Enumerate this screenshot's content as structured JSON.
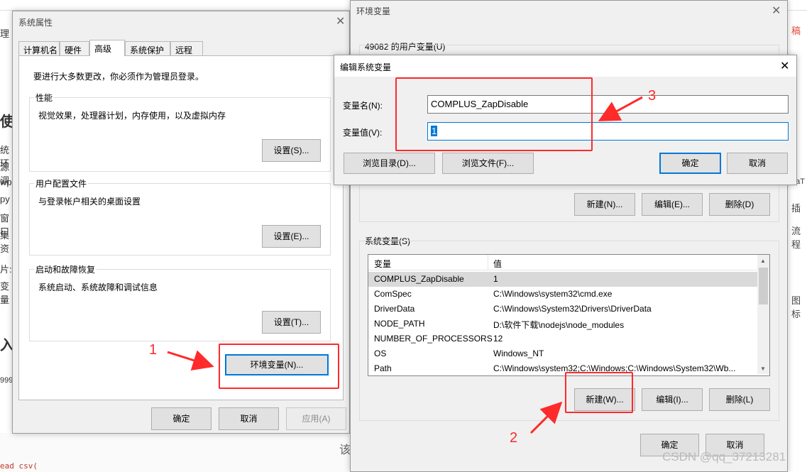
{
  "background": {
    "left_fragments": [
      "理",
      "使",
      "统环",
      "源调",
      "wp",
      "py",
      "窗口",
      "集资",
      "片:",
      "变量",
      "入",
      "999"
    ],
    "right_fragments": [
      "稿",
      "LaT",
      "插",
      "流程",
      "图标"
    ],
    "bottom_code": "ead csv(",
    "bottom_text": "该"
  },
  "system_properties": {
    "title": "系统属性",
    "tabs": [
      "计算机名",
      "硬件",
      "高级",
      "系统保护",
      "远程"
    ],
    "active_tab": "高级",
    "admin_note": "要进行大多数更改，你必须作为管理员登录。",
    "groups": [
      {
        "title": "性能",
        "desc": "视觉效果，处理器计划，内存使用，以及虚拟内存",
        "button": "设置(S)..."
      },
      {
        "title": "用户配置文件",
        "desc": "与登录帐户相关的桌面设置",
        "button": "设置(E)..."
      },
      {
        "title": "启动和故障恢复",
        "desc": "系统启动、系统故障和调试信息",
        "button": "设置(T)..."
      }
    ],
    "env_button": "环境变量(N)...",
    "ok": "确定",
    "cancel": "取消",
    "apply": "应用(A)"
  },
  "env_vars": {
    "title": "环境变量",
    "user_section": "49082 的用户变量(U)",
    "user_buttons": {
      "new": "新建(N)...",
      "edit": "编辑(E)...",
      "delete": "删除(D)"
    },
    "system_section": "系统变量(S)",
    "columns": [
      "变量",
      "值"
    ],
    "rows": [
      [
        "COMPLUS_ZapDisable",
        "1"
      ],
      [
        "ComSpec",
        "C:\\Windows\\system32\\cmd.exe"
      ],
      [
        "DriverData",
        "C:\\Windows\\System32\\Drivers\\DriverData"
      ],
      [
        "NODE_PATH",
        "D:\\软件下载\\nodejs\\node_modules"
      ],
      [
        "NUMBER_OF_PROCESSORS",
        "12"
      ],
      [
        "OS",
        "Windows_NT"
      ],
      [
        "Path",
        "C:\\Windows\\system32;C:\\Windows;C:\\Windows\\System32\\Wb..."
      ]
    ],
    "system_buttons": {
      "new": "新建(W)...",
      "edit": "编辑(I)...",
      "delete": "删除(L)"
    },
    "ok": "确定",
    "cancel": "取消"
  },
  "edit_dialog": {
    "title": "编辑系统变量",
    "name_label": "变量名(N):",
    "name_value": "COMPLUS_ZapDisable",
    "value_label": "变量值(V):",
    "value_value": "1",
    "browse_dir": "浏览目录(D)...",
    "browse_file": "浏览文件(F)...",
    "ok": "确定",
    "cancel": "取消"
  },
  "annotations": [
    "1",
    "2",
    "3"
  ],
  "annotation_color": "#ff2a2a",
  "accent_color": "#0078d7",
  "watermark": "CSDN @qq_37213281",
  "icons": {
    "close": "close-icon",
    "scroll_up": "scroll-up-icon",
    "scroll_down": "scroll-down-icon",
    "arrow": "arrow-icon"
  }
}
